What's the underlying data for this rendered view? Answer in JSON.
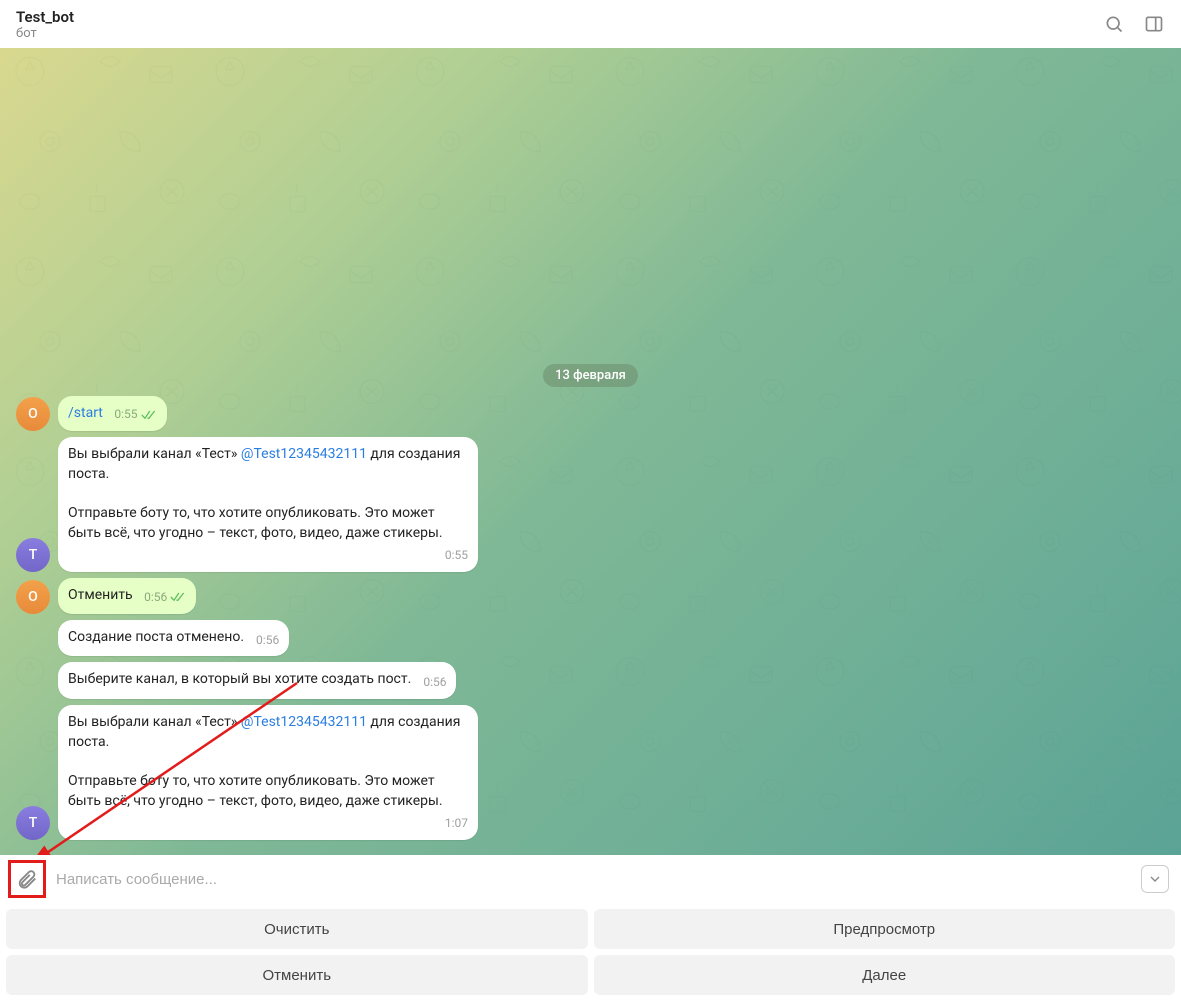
{
  "header": {
    "title": "Test_bot",
    "subtitle": "бот"
  },
  "date_chip": "13 февраля",
  "avatars": {
    "user_initial": "О",
    "bot_initial": "T"
  },
  "messages": {
    "m1": {
      "text": "/start",
      "time": "0:55"
    },
    "m2": {
      "part1": "Вы выбрали канал «Тест» ",
      "mention": "@Test12345432111",
      "part2": " для создания поста.",
      "line2": "Отправьте боту то, что хотите опубликовать. Это может быть всё, что угодно – текст, фото, видео, даже стикеры.",
      "time": "0:55"
    },
    "m3": {
      "text": "Отменить",
      "time": "0:56"
    },
    "m4": {
      "text": "Создание поста отменено.",
      "time": "0:56"
    },
    "m5": {
      "text": "Выберите канал, в который вы хотите создать пост.",
      "time": "0:56"
    },
    "m6": {
      "part1": "Вы выбрали канал «Тест» ",
      "mention": "@Test12345432111",
      "part2": " для создания поста.",
      "line2": "Отправьте боту то, что хотите опубликовать. Это может быть всё, что угодно – текст, фото, видео, даже стикеры.",
      "time": "1:07"
    }
  },
  "compose": {
    "placeholder": "Написать сообщение..."
  },
  "keyboard": {
    "r1c1": "Очистить",
    "r1c2": "Предпросмотр",
    "r2c1": "Отменить",
    "r2c2": "Далее"
  }
}
